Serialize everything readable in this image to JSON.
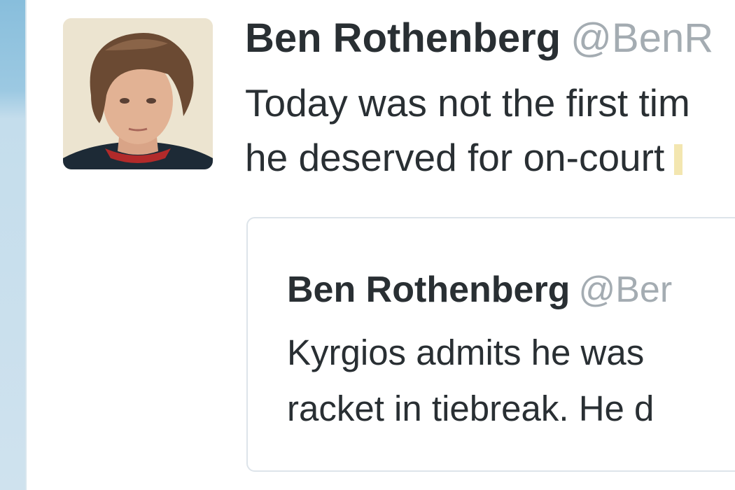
{
  "tweet": {
    "author_name": "Ben Rothenberg",
    "author_handle": "@BenR",
    "text_lines": [
      "Today was not the first tim",
      "he deserved for on-court"
    ]
  },
  "quoted_tweet": {
    "author_name": "Ben Rothenberg",
    "author_handle": "@Ber",
    "text_lines": [
      "Kyrgios admits he was",
      "racket in tiebreak. He d"
    ]
  },
  "colors": {
    "text_primary": "#292f33",
    "text_handle": "#a4acb2",
    "card_border": "#dde4ea",
    "rail": "#9cc9e2"
  }
}
